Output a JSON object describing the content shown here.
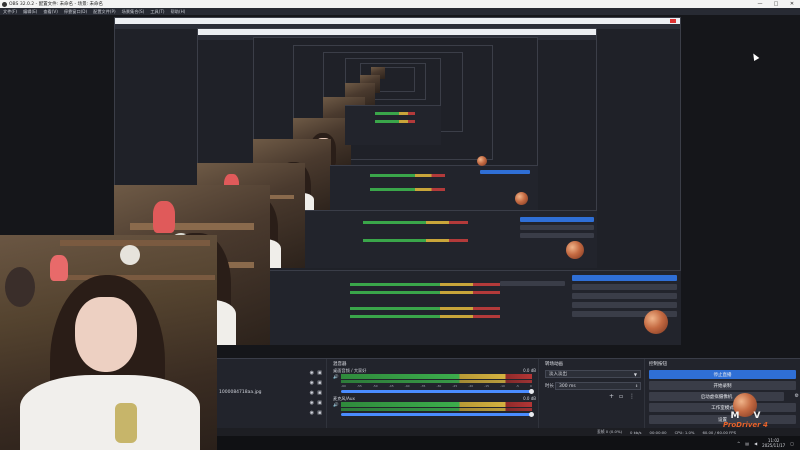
{
  "window": {
    "title": "OBS 32.0.2 - 配置文件: 未命名 - 场景: 未命名",
    "minimize": "—",
    "maximize": "□",
    "close": "✕"
  },
  "menu": [
    "文件(F)",
    "编辑(E)",
    "查看(V)",
    "停靠窗口(D)",
    "配置文件(P)",
    "场景集合(S)",
    "工具(T)",
    "帮助(H)"
  ],
  "sources": {
    "items": [
      {
        "label": ""
      },
      {
        "label": ""
      },
      {
        "label": "1000084718aa.jpg"
      },
      {
        "label": ""
      },
      {
        "label": ""
      }
    ]
  },
  "mixer": {
    "title": "混音器",
    "channels": [
      {
        "name": "桌面音频 / 大家好",
        "db": "0.0 dB"
      },
      {
        "name": "麦克风/Aux",
        "db": "0.0 dB"
      }
    ],
    "scale": [
      "-60",
      "-55",
      "-50",
      "-45",
      "-40",
      "-35",
      "-30",
      "-25",
      "-20",
      "-15",
      "-10",
      "-5",
      "0"
    ]
  },
  "transitions": {
    "title": "转场动画",
    "selected": "淡入淡出",
    "duration_label": "时长",
    "duration": "300 ms"
  },
  "controls": {
    "title": "控制按钮",
    "buttons": [
      {
        "label": "停止直播",
        "primary": true
      },
      {
        "label": "开始录制",
        "primary": false
      },
      {
        "label": "启动虚拟摄像机",
        "primary": false
      },
      {
        "label": "工作室模式",
        "primary": false
      },
      {
        "label": "设置",
        "primary": false
      }
    ]
  },
  "status": {
    "dropped": "丢帧 0 (0.0%)",
    "bitrate": "0 kb/s",
    "time": "00:00:00",
    "cpu": "CPU: 1.0%",
    "fps": "60.00 / 60.00 FPS"
  },
  "taskbar": {
    "time": "11:02",
    "date": "2025/11/17"
  },
  "logo": {
    "m": "M",
    "v": "V",
    "brand": "ProDriver 4"
  },
  "colors": {
    "accent": "#2f6fd6",
    "background": "#1d1e23",
    "brand_orange": "#e8622a"
  }
}
